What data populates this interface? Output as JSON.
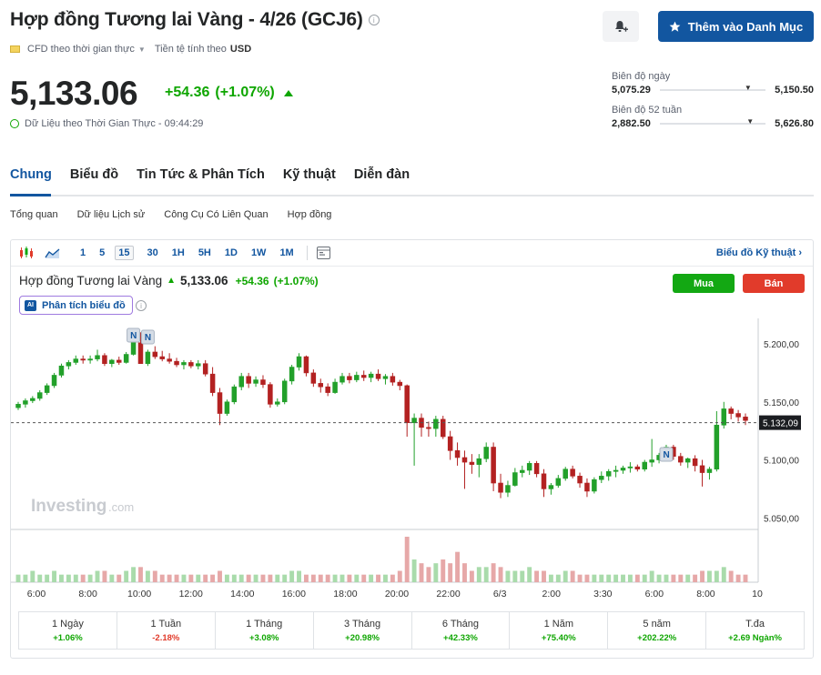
{
  "header": {
    "title": "Hợp đồng Tương lai Vàng - 4/26 (GCJ6)",
    "watchlist_label": "Thêm vào Danh Mục",
    "cfd_label": "CFD theo thời gian thực",
    "currency_label": "Tiền tệ tính theo",
    "currency": "USD"
  },
  "quote": {
    "price": "5,133.06",
    "change": "+54.36",
    "change_pct": "(+1.07%)",
    "realtime_label": "Dữ Liệu theo Thời Gian Thực",
    "time": "09:44:29"
  },
  "ranges": {
    "day": {
      "label": "Biên độ ngày",
      "low": "5,075.29",
      "high": "5,150.50",
      "position": 0.8
    },
    "week52": {
      "label": "Biên độ 52 tuần",
      "low": "2,882.50",
      "high": "5,626.80",
      "position": 0.82
    }
  },
  "tabs": [
    {
      "label": "Chung",
      "active": true
    },
    {
      "label": "Biểu đồ",
      "active": false
    },
    {
      "label": "Tin Tức & Phân Tích",
      "active": false
    },
    {
      "label": "Kỹ thuật",
      "active": false
    },
    {
      "label": "Diễn đàn",
      "active": false
    }
  ],
  "subtabs": [
    "Tổng quan",
    "Dữ liệu Lịch sử",
    "Công Cụ Có Liên Quan",
    "Hợp đồng"
  ],
  "toolbar": {
    "intervals": [
      "1",
      "5",
      "15",
      "30",
      "1H",
      "5H",
      "1D",
      "1W",
      "1M"
    ],
    "selected": "15",
    "tech_chart_link": "Biểu đồ Kỹ thuật ›"
  },
  "chart_head": {
    "name": "Hợp đồng Tương lai Vàng",
    "price": "5,133.06",
    "change": "+54.36",
    "change_pct": "(+1.07%)",
    "buy_label": "Mua",
    "sell_label": "Bán",
    "ai_label": "Phân tích biểu đồ",
    "ai_badge": "AI",
    "watermark": "Investing",
    "watermark_suffix": ".com",
    "current_price_label": "5.132,09",
    "news_marker": "N"
  },
  "colors": {
    "up": "#22a02a",
    "down": "#b32121",
    "accent": "#1256a0"
  },
  "chart_data": {
    "type": "candlestick",
    "interval": "15",
    "y_ticks": [
      "5.200,00",
      "5.150,00",
      "5.100,00",
      "5.050,00"
    ],
    "y_tick_values": [
      5200,
      5150,
      5100,
      5050
    ],
    "ylim": [
      5040,
      5222
    ],
    "current_price": 5132.09,
    "x_ticks": [
      "6:00",
      "8:00",
      "10:00",
      "12:00",
      "14:00",
      "16:00",
      "18:00",
      "20:00",
      "22:00",
      "6/3",
      "2:00",
      "3:30",
      "6:00",
      "8:00",
      "10"
    ],
    "candles": [
      [
        5145,
        5150,
        5143,
        5148
      ],
      [
        5148,
        5153,
        5145,
        5151
      ],
      [
        5151,
        5155,
        5149,
        5153
      ],
      [
        5153,
        5160,
        5151,
        5158
      ],
      [
        5158,
        5166,
        5156,
        5164
      ],
      [
        5164,
        5175,
        5162,
        5173
      ],
      [
        5173,
        5183,
        5171,
        5181
      ],
      [
        5181,
        5186,
        5178,
        5184
      ],
      [
        5184,
        5190,
        5182,
        5187
      ],
      [
        5187,
        5190,
        5183,
        5186
      ],
      [
        5186,
        5190,
        5183,
        5187
      ],
      [
        5187,
        5195,
        5185,
        5190
      ],
      [
        5190,
        5192,
        5181,
        5183
      ],
      [
        5183,
        5187,
        5180,
        5186
      ],
      [
        5186,
        5189,
        5182,
        5184
      ],
      [
        5184,
        5193,
        5183,
        5191
      ],
      [
        5191,
        5204,
        5190,
        5201
      ],
      [
        5201,
        5210,
        5198,
        5183
      ],
      [
        5183,
        5195,
        5181,
        5193
      ],
      [
        5193,
        5198,
        5187,
        5189
      ],
      [
        5189,
        5194,
        5185,
        5187
      ],
      [
        5187,
        5192,
        5183,
        5185
      ],
      [
        5185,
        5188,
        5180,
        5182
      ],
      [
        5182,
        5186,
        5178,
        5184
      ],
      [
        5184,
        5186,
        5179,
        5181
      ],
      [
        5181,
        5186,
        5178,
        5183
      ],
      [
        5183,
        5186,
        5172,
        5174
      ],
      [
        5174,
        5180,
        5155,
        5158
      ],
      [
        5158,
        5162,
        5130,
        5140
      ],
      [
        5140,
        5152,
        5138,
        5150
      ],
      [
        5150,
        5165,
        5148,
        5163
      ],
      [
        5163,
        5175,
        5160,
        5172
      ],
      [
        5172,
        5175,
        5162,
        5166
      ],
      [
        5166,
        5172,
        5163,
        5169
      ],
      [
        5169,
        5173,
        5162,
        5165
      ],
      [
        5165,
        5167,
        5145,
        5148
      ],
      [
        5148,
        5153,
        5146,
        5150
      ],
      [
        5150,
        5170,
        5148,
        5168
      ],
      [
        5168,
        5182,
        5165,
        5180
      ],
      [
        5180,
        5192,
        5177,
        5189
      ],
      [
        5189,
        5190,
        5172,
        5175
      ],
      [
        5175,
        5178,
        5163,
        5166
      ],
      [
        5166,
        5170,
        5158,
        5163
      ],
      [
        5163,
        5166,
        5155,
        5158
      ],
      [
        5158,
        5170,
        5157,
        5167
      ],
      [
        5167,
        5175,
        5165,
        5172
      ],
      [
        5172,
        5175,
        5166,
        5169
      ],
      [
        5169,
        5176,
        5167,
        5173
      ],
      [
        5173,
        5177,
        5168,
        5171
      ],
      [
        5171,
        5176,
        5167,
        5174
      ],
      [
        5174,
        5178,
        5168,
        5170
      ],
      [
        5170,
        5174,
        5165,
        5172
      ],
      [
        5172,
        5175,
        5164,
        5167
      ],
      [
        5167,
        5169,
        5160,
        5164
      ],
      [
        5164,
        5165,
        5120,
        5132
      ],
      [
        5132,
        5140,
        5095,
        5136
      ],
      [
        5136,
        5140,
        5120,
        5128
      ],
      [
        5128,
        5133,
        5120,
        5127
      ],
      [
        5127,
        5138,
        5120,
        5135
      ],
      [
        5135,
        5138,
        5118,
        5120
      ],
      [
        5120,
        5125,
        5100,
        5108
      ],
      [
        5108,
        5115,
        5095,
        5102
      ],
      [
        5102,
        5108,
        5075,
        5098
      ],
      [
        5098,
        5105,
        5088,
        5096
      ],
      [
        5096,
        5105,
        5085,
        5101
      ],
      [
        5101,
        5115,
        5098,
        5111
      ],
      [
        5111,
        5115,
        5073,
        5080
      ],
      [
        5080,
        5088,
        5067,
        5072
      ],
      [
        5072,
        5082,
        5068,
        5078
      ],
      [
        5078,
        5093,
        5077,
        5089
      ],
      [
        5089,
        5095,
        5085,
        5091
      ],
      [
        5091,
        5099,
        5087,
        5097
      ],
      [
        5097,
        5099,
        5085,
        5088
      ],
      [
        5088,
        5092,
        5068,
        5075
      ],
      [
        5075,
        5080,
        5070,
        5078
      ],
      [
        5078,
        5087,
        5076,
        5084
      ],
      [
        5084,
        5094,
        5082,
        5092
      ],
      [
        5092,
        5095,
        5084,
        5086
      ],
      [
        5086,
        5089,
        5076,
        5080
      ],
      [
        5080,
        5084,
        5068,
        5073
      ],
      [
        5073,
        5085,
        5071,
        5083
      ],
      [
        5083,
        5090,
        5080,
        5086
      ],
      [
        5086,
        5092,
        5082,
        5090
      ],
      [
        5090,
        5095,
        5085,
        5091
      ],
      [
        5091,
        5095,
        5088,
        5093
      ],
      [
        5093,
        5098,
        5089,
        5094
      ],
      [
        5094,
        5096,
        5090,
        5092
      ],
      [
        5092,
        5100,
        5090,
        5098
      ],
      [
        5098,
        5118,
        5094,
        5100
      ],
      [
        5100,
        5106,
        5097,
        5104
      ],
      [
        5104,
        5113,
        5101,
        5111
      ],
      [
        5111,
        5113,
        5100,
        5103
      ],
      [
        5103,
        5106,
        5095,
        5098
      ],
      [
        5098,
        5102,
        5093,
        5101
      ],
      [
        5101,
        5104,
        5090,
        5095
      ],
      [
        5095,
        5100,
        5077,
        5089
      ],
      [
        5089,
        5094,
        5083,
        5092
      ],
      [
        5092,
        5142,
        5090,
        5130
      ],
      [
        5130,
        5150,
        5127,
        5144
      ],
      [
        5144,
        5146,
        5135,
        5140
      ],
      [
        5140,
        5143,
        5133,
        5137
      ],
      [
        5137,
        5140,
        5130,
        5134
      ]
    ],
    "volumes": [
      2,
      2,
      3,
      2,
      2,
      3,
      2,
      2,
      2,
      2,
      2,
      3,
      3,
      2,
      2,
      3,
      4,
      4,
      3,
      3,
      2,
      2,
      2,
      2,
      2,
      2,
      2,
      2,
      3,
      2,
      2,
      2,
      2,
      2,
      2,
      2,
      2,
      2,
      3,
      3,
      2,
      2,
      2,
      2,
      2,
      2,
      2,
      2,
      2,
      2,
      2,
      2,
      2,
      3,
      12,
      6,
      5,
      4,
      5,
      6,
      5,
      8,
      5,
      3,
      4,
      4,
      5,
      4,
      3,
      3,
      3,
      4,
      3,
      3,
      2,
      2,
      3,
      3,
      2,
      2,
      2,
      2,
      2,
      2,
      2,
      2,
      2,
      2,
      3,
      2,
      2,
      2,
      2,
      2,
      2,
      3,
      3,
      3,
      4,
      3,
      2,
      2
    ]
  },
  "performance": [
    {
      "label": "1 Ngày",
      "value": "+1.06%",
      "sign": "pos"
    },
    {
      "label": "1 Tuần",
      "value": "-2.18%",
      "sign": "neg"
    },
    {
      "label": "1 Tháng",
      "value": "+3.08%",
      "sign": "pos"
    },
    {
      "label": "3 Tháng",
      "value": "+20.98%",
      "sign": "pos"
    },
    {
      "label": "6 Tháng",
      "value": "+42.33%",
      "sign": "pos"
    },
    {
      "label": "1 Năm",
      "value": "+75.40%",
      "sign": "pos"
    },
    {
      "label": "5 năm",
      "value": "+202.22%",
      "sign": "pos"
    },
    {
      "label": "T.đa",
      "value": "+2.69 Ngàn%",
      "sign": "pos"
    }
  ]
}
